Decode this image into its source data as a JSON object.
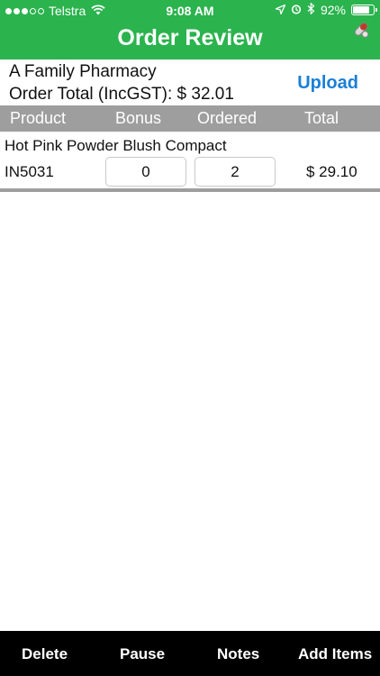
{
  "status_bar": {
    "carrier": "Telstra",
    "time": "9:08 AM",
    "battery": "92%",
    "battery_level": 0.92,
    "signal_bars": 3,
    "signal_total": 5
  },
  "header": {
    "title": "Order Review",
    "color": "#2bb34e",
    "tools_icon": "pill-tools-icon"
  },
  "order": {
    "pharmacy": "A Family Pharmacy",
    "total_label": "Order Total (IncGST): $ 32.01",
    "upload_label": "Upload"
  },
  "table": {
    "columns": [
      "Product",
      "Bonus",
      "Ordered",
      "Total"
    ],
    "rows": [
      {
        "name": "Hot Pink Powder Blush Compact",
        "code": "IN5031",
        "bonus": "0",
        "ordered": "2",
        "total": "$ 29.10"
      }
    ]
  },
  "footer": {
    "delete_label": "Delete",
    "pause_label": "Pause",
    "notes_label": "Notes",
    "add_items_label": "Add Items"
  }
}
